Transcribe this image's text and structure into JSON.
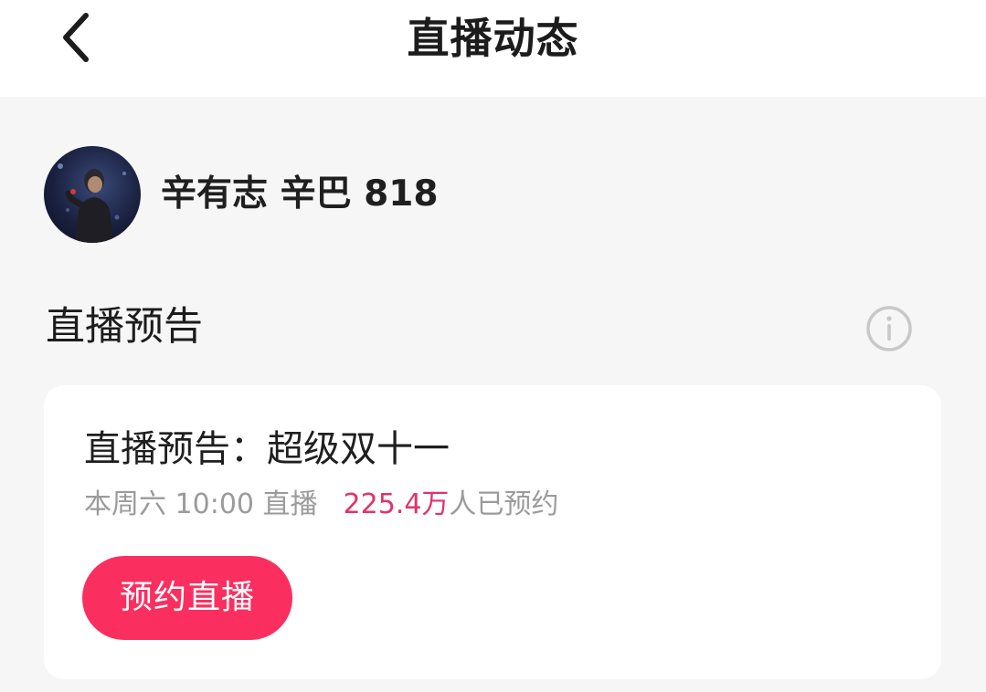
{
  "header": {
    "title": "直播动态",
    "back_icon": "chevron-left-icon"
  },
  "profile": {
    "name": "辛有志 辛巴 818",
    "avatar": "avatar-photo"
  },
  "section": {
    "title": "直播预告",
    "info_icon": "info-circle-icon"
  },
  "card": {
    "title": "直播预告：超级双十一",
    "schedule": "本周六 10:00 直播",
    "reserve_count": "225.4万",
    "reserve_suffix": "人已预约",
    "button_label": "预约直播"
  },
  "colors": {
    "accent": "#fb2f5f",
    "count_text": "#e2336b",
    "muted_text": "#9b9b9b",
    "background": "#f6f6f6"
  }
}
